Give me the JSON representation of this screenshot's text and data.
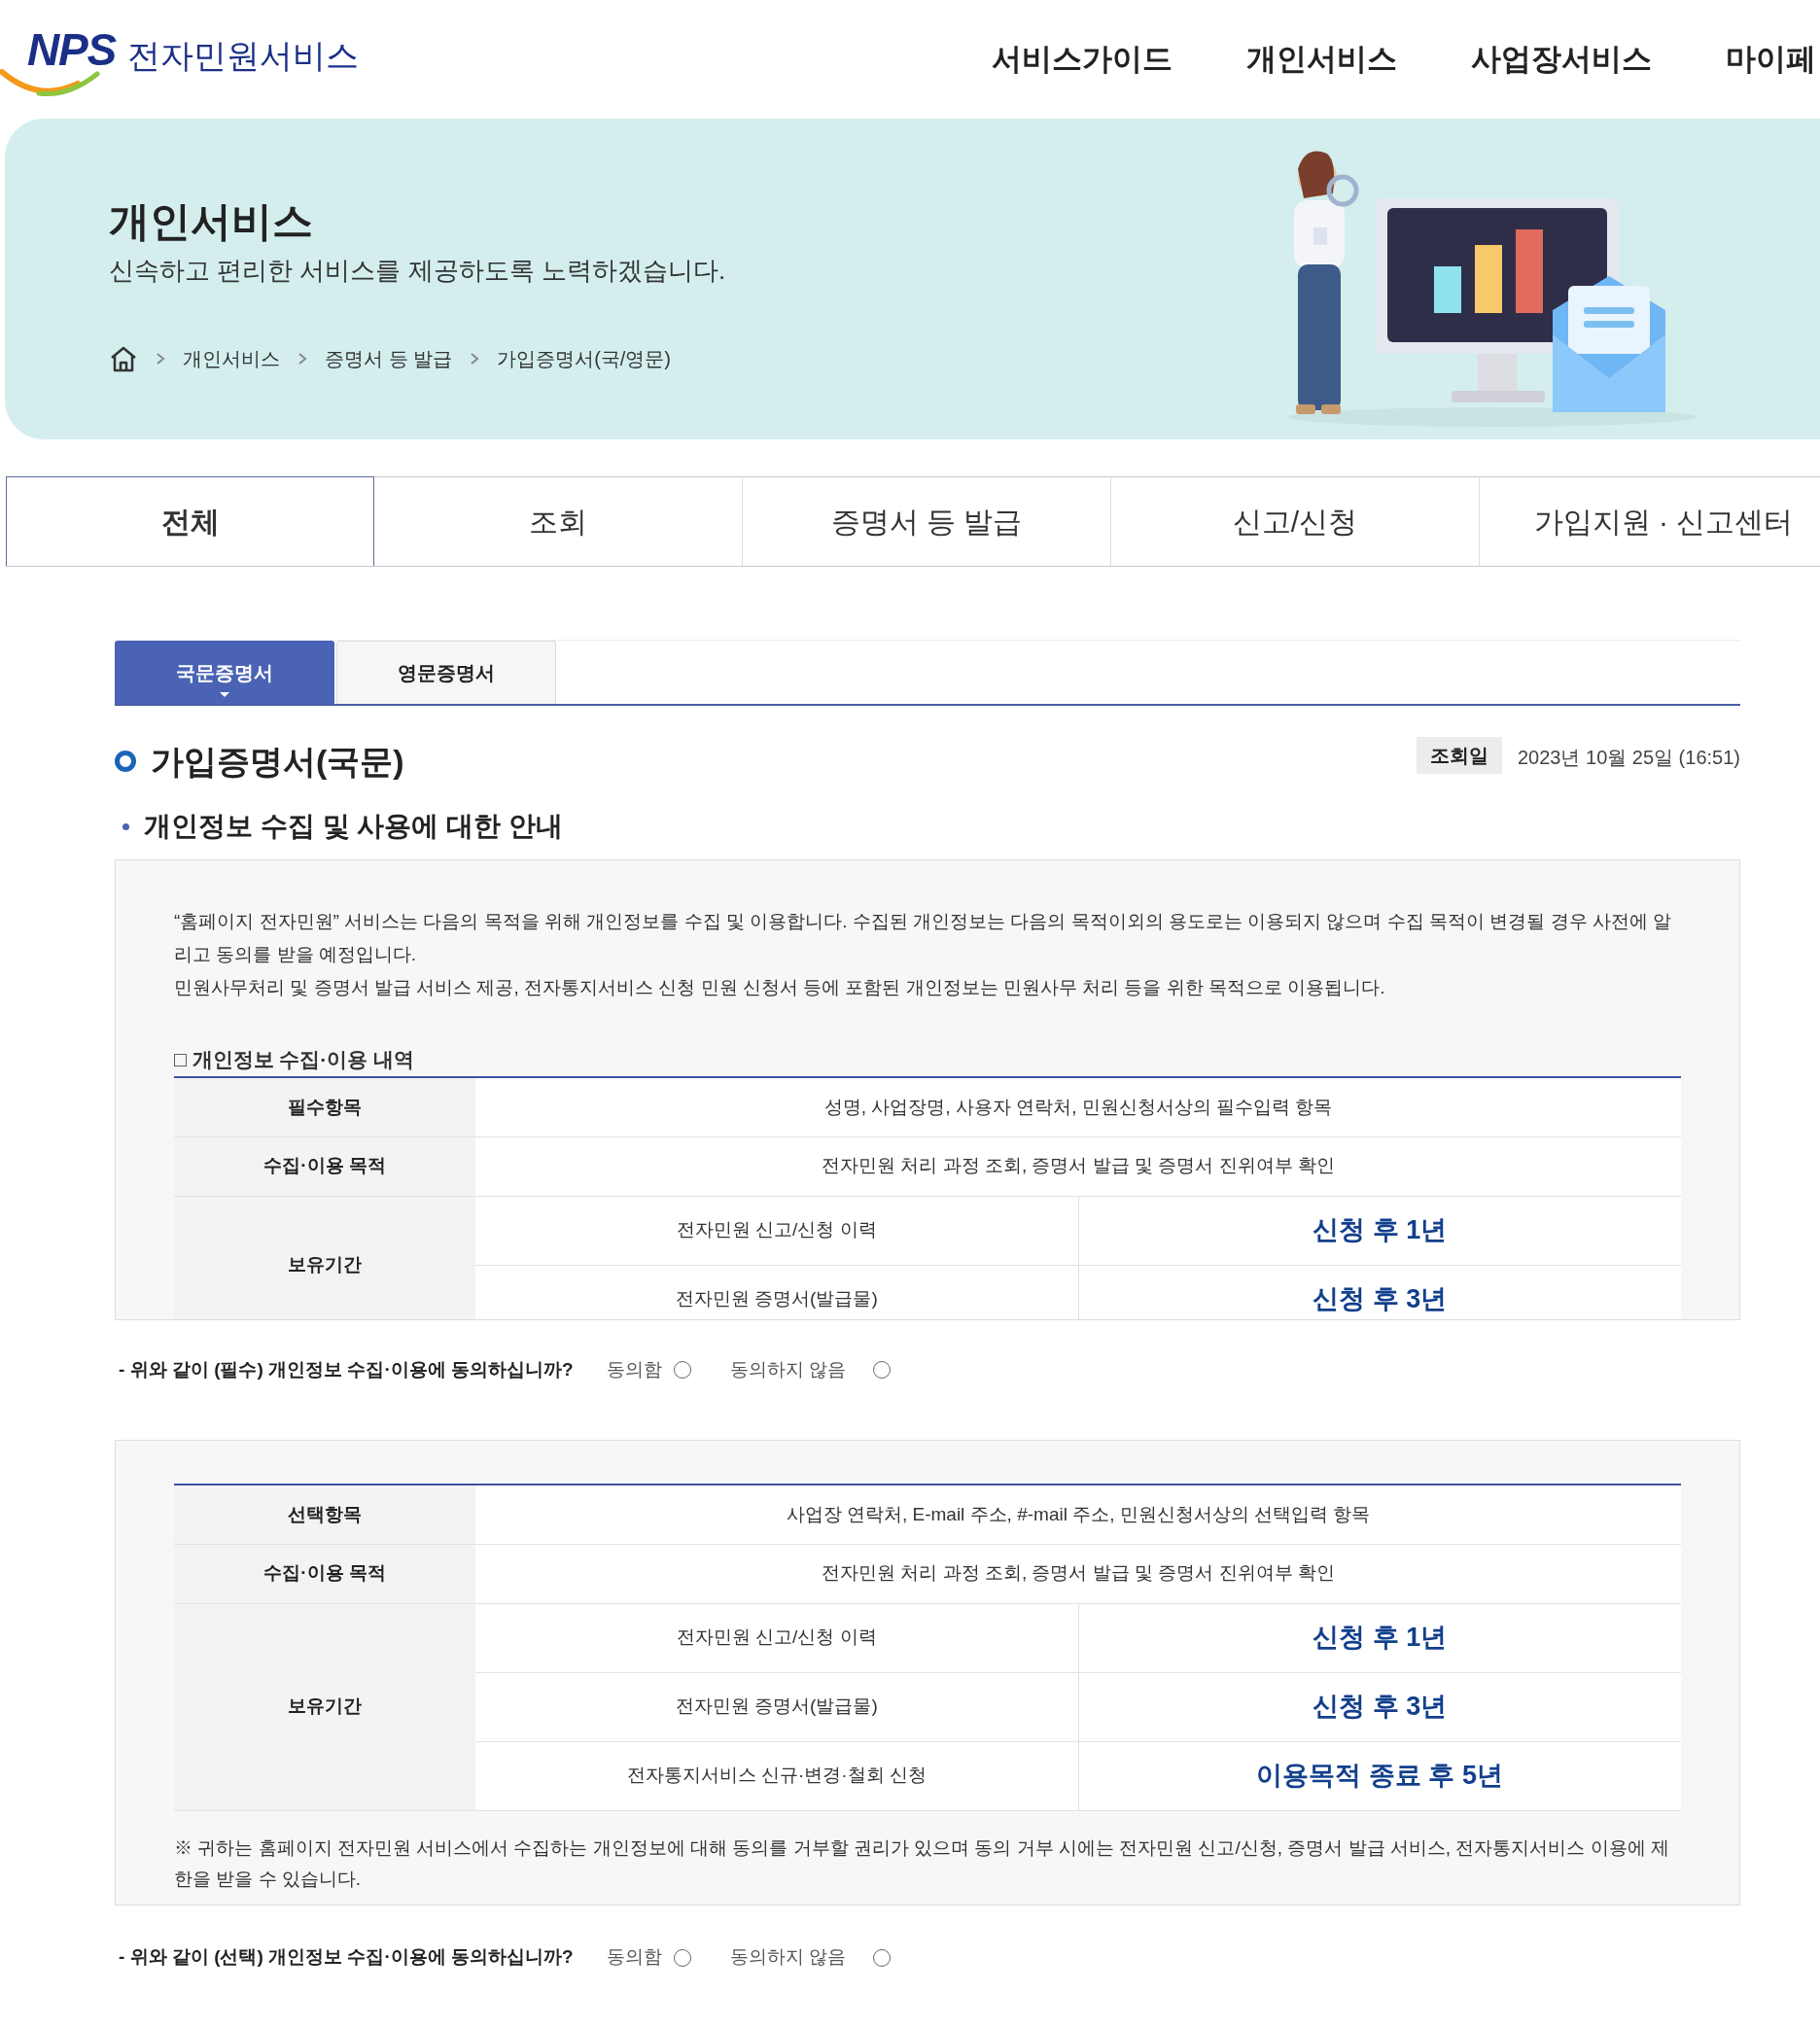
{
  "header": {
    "logo": {
      "mark": "NPS",
      "title": "전자민원서비스"
    },
    "nav": [
      "서비스가이드",
      "개인서비스",
      "사업장서비스",
      "마이페"
    ]
  },
  "hero": {
    "title": "개인서비스",
    "subtitle": "신속하고 편리한 서비스를 제공하도록 노력하겠습니다.",
    "breadcrumb": [
      "개인서비스",
      "증명서 등 발급",
      "가입증명서(국/영문)"
    ]
  },
  "main_tabs": [
    {
      "label": "전체",
      "selected": true
    },
    {
      "label": "조회",
      "selected": false
    },
    {
      "label": "증명서 등 발급",
      "selected": false
    },
    {
      "label": "신고/신청",
      "selected": false
    },
    {
      "label": "가입지원 · 신고센터",
      "selected": false
    }
  ],
  "sub_tabs": [
    {
      "label": "국문증명서",
      "selected": true
    },
    {
      "label": "영문증명서",
      "selected": false
    }
  ],
  "page_title": "가입증명서(국문)",
  "lookup": {
    "label": "조회일",
    "value": "2023년 10월 25일 (16:51)"
  },
  "section_title": "개인정보 수집 및 사용에 대한 안내",
  "required_box": {
    "paragraphs": [
      "“홈페이지 전자민원” 서비스는 다음의 목적을 위해 개인정보를 수집 및 이용합니다. 수집된 개인정보는 다음의 목적이외의 용도로는 이용되지 않으며 수집 목적이 변경될 경우 사전에 알리고 동의를 받을 예정입니다.",
      "민원사무처리 및 증명서 발급 서비스 제공, 전자통지서비스 신청 민원 신청서 등에 포함된 개인정보는 민원사무 처리 등을 위한 목적으로 이용됩니다."
    ],
    "table_title": "□ 개인정보 수집·이용 내역",
    "table": {
      "rows": [
        {
          "header": "필수항목",
          "value": "성명, 사업장명, 사용자 연락처, 민원신청서상의 필수입력 항목"
        },
        {
          "header": "수집·이용 목적",
          "value": "전자민원 처리 과정 조회, 증명서 발급 및 증명서 진위여부 확인"
        }
      ],
      "retention": {
        "header": "보유기간",
        "items": [
          {
            "item": "전자민원 신고/신청 이력",
            "period": "신청 후 1년"
          },
          {
            "item": "전자민원 증명서(발급물)",
            "period": "신청 후 3년"
          }
        ]
      }
    }
  },
  "required_consent": {
    "question": "- 위와 같이 (필수) 개인정보 수집·이용에 동의하십니까?",
    "options": [
      {
        "label": "동의함",
        "selected": false
      },
      {
        "label": "동의하지 않음",
        "selected": false
      }
    ]
  },
  "optional_box": {
    "table": {
      "rows": [
        {
          "header": "선택항목",
          "value": "사업장 연락처, E-mail 주소, #-mail 주소, 민원신청서상의 선택입력 항목"
        },
        {
          "header": "수집·이용 목적",
          "value": "전자민원 처리 과정 조회, 증명서 발급 및 증명서 진위여부 확인"
        }
      ],
      "retention": {
        "header": "보유기간",
        "items": [
          {
            "item": "전자민원 신고/신청 이력",
            "period": "신청 후 1년"
          },
          {
            "item": "전자민원 증명서(발급물)",
            "period": "신청 후 3년"
          },
          {
            "item": "전자통지서비스 신규·변경·철회 신청",
            "period": "이용목적 종료 후 5년"
          }
        ]
      }
    },
    "note": "※ 귀하는 홈페이지 전자민원 서비스에서 수집하는 개인정보에 대해 동의를 거부할 권리가 있으며 동의 거부 시에는 전자민원 신고/신청, 증명서 발급 서비스, 전자통지서비스 이용에 제한을 받을 수 있습니다."
  },
  "optional_consent": {
    "question": "- 위와 같이 (선택) 개인정보 수집·이용에 동의하십니까?",
    "options": [
      {
        "label": "동의함",
        "selected": false
      },
      {
        "label": "동의하지 않음",
        "selected": false
      }
    ]
  }
}
